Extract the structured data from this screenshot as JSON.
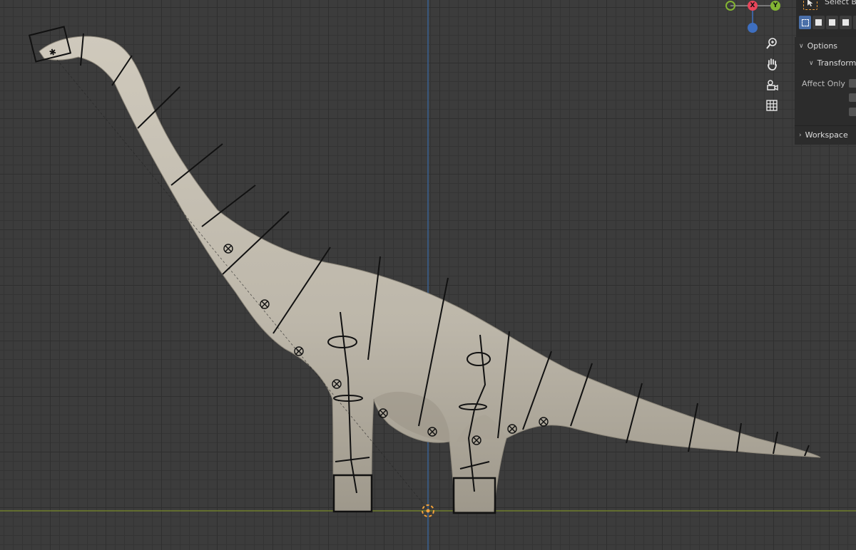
{
  "viewport": {
    "gizmo": {
      "x_label": "X",
      "y_label": "Y",
      "x_color": "#e8455a",
      "y_color": "#83b433",
      "z_color": "#3e6fc0"
    },
    "nav_icons": [
      "zoom-icon",
      "pan-hand-icon",
      "camera-icon",
      "grid-icon"
    ],
    "colors": {
      "axis_x": "#7a8a2a",
      "axis_z": "#3a6aa8",
      "skin": "#bdb7aa",
      "bone": "#111111",
      "origin": "#f2a23a"
    }
  },
  "tool_header": {
    "select_label": "Select B"
  },
  "options_panel": {
    "options_label": "Options",
    "transform_label": "Transform",
    "affect_only_label": "Affect Only"
  },
  "workspace_panel": {
    "label": "Workspace"
  }
}
